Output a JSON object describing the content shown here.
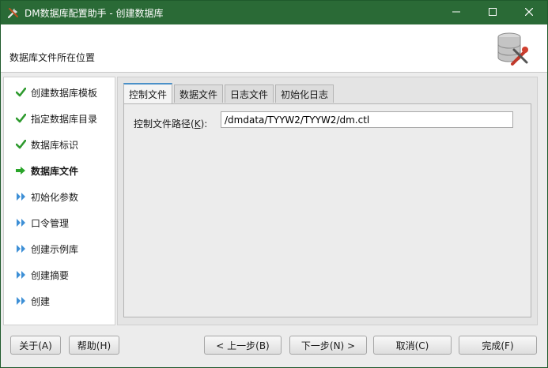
{
  "window": {
    "title": "DM数据库配置助手 - 创建数据库",
    "minimize_glyph": "—",
    "maximize_glyph": "☐",
    "close_glyph": "✕"
  },
  "header": {
    "title": "数据库文件所在位置",
    "logo_icon": "database-tools-icon"
  },
  "steps": [
    {
      "label": "创建数据库模板",
      "status": "done",
      "icon": "check-icon"
    },
    {
      "label": "指定数据库目录",
      "status": "done",
      "icon": "check-icon"
    },
    {
      "label": "数据库标识",
      "status": "done",
      "icon": "check-icon"
    },
    {
      "label": "数据库文件",
      "status": "current",
      "icon": "arrow-right-icon"
    },
    {
      "label": "初始化参数",
      "status": "pending",
      "icon": "double-arrow-icon"
    },
    {
      "label": "口令管理",
      "status": "pending",
      "icon": "double-arrow-icon"
    },
    {
      "label": "创建示例库",
      "status": "pending",
      "icon": "double-arrow-icon"
    },
    {
      "label": "创建摘要",
      "status": "pending",
      "icon": "double-arrow-icon"
    },
    {
      "label": "创建",
      "status": "pending",
      "icon": "double-arrow-icon"
    }
  ],
  "tabs": [
    {
      "label": "控制文件",
      "active": true
    },
    {
      "label": "数据文件",
      "active": false
    },
    {
      "label": "日志文件",
      "active": false
    },
    {
      "label": "初始化日志",
      "active": false
    }
  ],
  "control_file": {
    "label_prefix": "控制文件路径(",
    "label_mnemonic": "K",
    "label_suffix": "):",
    "value": "/dmdata/TYYW2/TYYW2/dm.ctl"
  },
  "buttons": {
    "about": "关于(A)",
    "help": "帮助(H)",
    "prev": "< 上一步(B)",
    "next": "下一步(N) >",
    "cancel": "取消(C)",
    "finish": "完成(F)"
  },
  "colors": {
    "titlebar": "#2a6a36",
    "check": "#2e9a2e",
    "current_arrow": "#2aa52a",
    "pending_arrow": "#3d8fd6",
    "active_tab_accent": "#4a90c8"
  }
}
